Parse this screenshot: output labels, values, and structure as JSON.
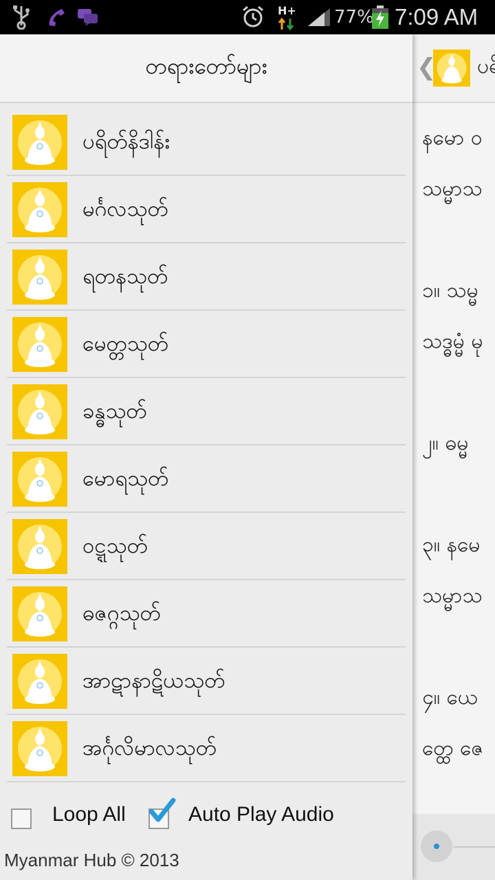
{
  "status_bar": {
    "battery_percent": "77%",
    "time": "7:09 AM",
    "network_type": "H+",
    "icons": [
      "usb-icon",
      "call-icon",
      "message-icon",
      "alarm-icon",
      "network-icon",
      "signal-icon",
      "battery-charging-icon"
    ]
  },
  "drawer": {
    "title": "တရားတော်များ",
    "items": [
      {
        "label": "ပရိတ်နိဒါန်း",
        "icon": "buddha-icon"
      },
      {
        "label": "မင်္ဂလသုတ်",
        "icon": "buddha-icon"
      },
      {
        "label": "ရတနသုတ်",
        "icon": "buddha-icon"
      },
      {
        "label": "မေတ္တသုတ်",
        "icon": "buddha-icon"
      },
      {
        "label": "ခန္ဓသုတ်",
        "icon": "buddha-icon"
      },
      {
        "label": "မောရသုတ်",
        "icon": "buddha-icon"
      },
      {
        "label": "ဝဋ္ဋသုတ်",
        "icon": "buddha-icon"
      },
      {
        "label": "ဓဇဂ္ဂသုတ်",
        "icon": "buddha-icon"
      },
      {
        "label": "အာဋာနာဋိယသုတ်",
        "icon": "buddha-icon"
      },
      {
        "label": "အင်္ဂုလိမာလသုတ်",
        "icon": "buddha-icon"
      }
    ],
    "options": {
      "loop_all_label": "Loop All",
      "loop_all_checked": false,
      "auto_play_label": "Auto Play Audio",
      "auto_play_checked": true
    },
    "footer": "Myanmar Hub © 2013"
  },
  "content_panel": {
    "back_glyph": "❮",
    "title_fragment": "ပရိ",
    "lines": [
      "နမော ဝ",
      "သမ္မာသ",
      "၁။ သမ္မ",
      "သဒ္ဓမ္မံ မု",
      "၂။ ဓမ္မ",
      "၃။ နမေ",
      "သမ္မာသ",
      "၄။ ယေ",
      "တ္ထေ ဇေ"
    ]
  },
  "colors": {
    "accent": "#f5c400",
    "check": "#2a9ad8"
  }
}
